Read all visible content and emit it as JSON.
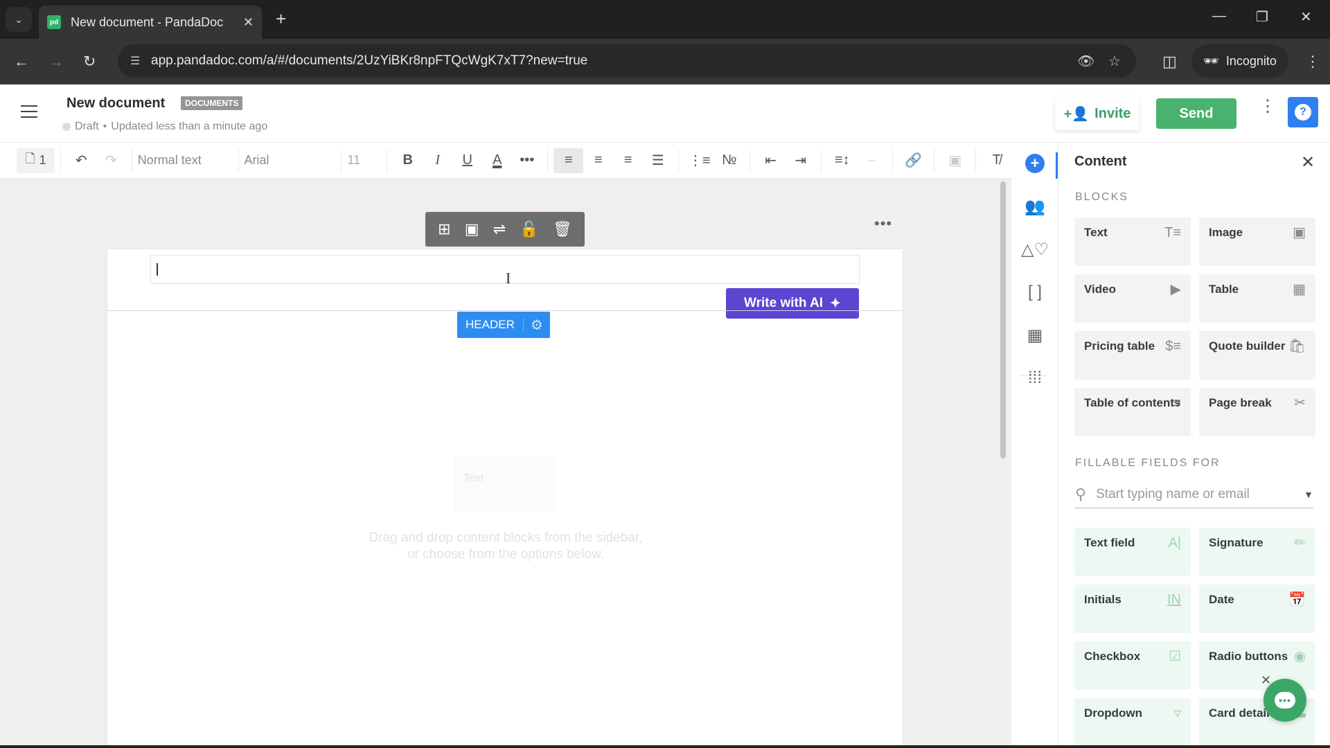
{
  "browser": {
    "tab_title": "New document - PandaDoc",
    "favicon": "pd",
    "url": "app.pandadoc.com/a/#/documents/2UzYiBKr8npFTQcWgK7xT7?new=true",
    "profile_label": "Incognito"
  },
  "header": {
    "title": "New document",
    "badge": "DOCUMENTS",
    "status": "Draft",
    "updated": "Updated less than a minute ago",
    "invite_label": "Invite",
    "send_label": "Send",
    "help_label": "?"
  },
  "toolbar": {
    "page_count": "1",
    "text_style": "Normal text",
    "font": "Arial",
    "font_size": "11"
  },
  "editor": {
    "write_ai_label": "Write with AI",
    "header_tag": "HEADER",
    "ghost_block": "Text",
    "hint_line1": "Drag and drop content blocks from the sidebar,",
    "hint_line2": "or choose from the options below."
  },
  "panel": {
    "title": "Content",
    "blocks_heading": "BLOCKS",
    "blocks": [
      {
        "label": "Text",
        "icon": "text-icon"
      },
      {
        "label": "Image",
        "icon": "image-icon"
      },
      {
        "label": "Video",
        "icon": "video-icon"
      },
      {
        "label": "Table",
        "icon": "table-icon"
      },
      {
        "label": "Pricing table",
        "icon": "pricing-icon"
      },
      {
        "label": "Quote builder",
        "icon": "bag-icon"
      },
      {
        "label": "Table of contents",
        "icon": "toc-icon"
      },
      {
        "label": "Page break",
        "icon": "scissors-icon"
      }
    ],
    "fields_heading": "FILLABLE FIELDS FOR",
    "search_placeholder": "Start typing name or email",
    "fields": [
      {
        "label": "Text field",
        "icon": "text-field-icon"
      },
      {
        "label": "Signature",
        "icon": "signature-icon"
      },
      {
        "label": "Initials",
        "icon": "initials-icon"
      },
      {
        "label": "Date",
        "icon": "calendar-icon"
      },
      {
        "label": "Checkbox",
        "icon": "checkbox-icon"
      },
      {
        "label": "Radio buttons",
        "icon": "radio-icon"
      },
      {
        "label": "Dropdown",
        "icon": "dropdown-icon"
      },
      {
        "label": "Card details",
        "icon": "card-icon"
      }
    ]
  },
  "colors": {
    "send_green": "#48b36e",
    "ai_purple": "#5b45d1",
    "header_blue": "#2d8cf0",
    "accent_blue": "#2f7ff0"
  }
}
